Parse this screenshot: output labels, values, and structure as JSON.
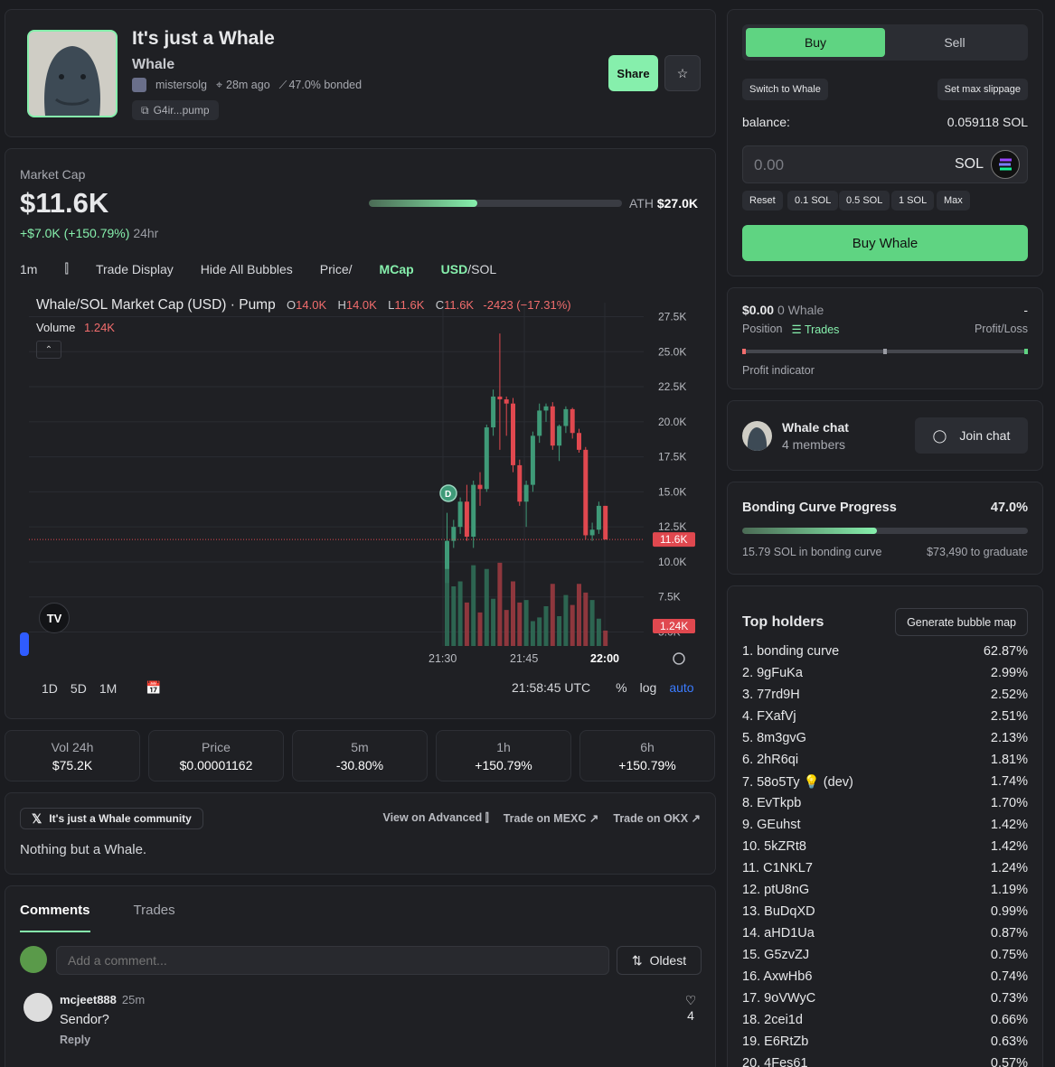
{
  "token": {
    "name": "It's just a Whale",
    "symbol": "Whale",
    "creator": "mistersolg",
    "age": "28m ago",
    "bonded": "47.0% bonded",
    "ca": "G4ir...pump",
    "share_label": "Share"
  },
  "market": {
    "label": "Market Cap",
    "value": "$11.6K",
    "change": "+$7.0K (+150.79%)",
    "period": "24hr",
    "ath_label": "ATH",
    "ath_value": "$27.0K",
    "ath_progress": 0.43
  },
  "toolbar": {
    "interval": "1m",
    "trade_display": "Trade Display",
    "hide_bubbles": "Hide All Bubbles",
    "price": "Price/",
    "mcap": "MCap",
    "usd": "USD",
    "sol": "/SOL"
  },
  "chart": {
    "title": "Whale/SOL Market Cap (USD) · Pump",
    "o_label": "O",
    "o": "14.0K",
    "h_label": "H",
    "h": "14.0K",
    "l_label": "L",
    "l": "11.6K",
    "c_label": "C",
    "c": "11.6K",
    "change": "-2423 (−17.31%)",
    "volume_label": "Volume",
    "volume_value": "1.24K",
    "current_price_tag": "11.6K",
    "current_volume_tag": "1.24K",
    "time_utc": "21:58:45 UTC",
    "ranges": [
      "1D",
      "5D",
      "1M"
    ],
    "scale_opts": {
      "pct": "%",
      "log": "log",
      "auto": "auto"
    },
    "dev_marker": "D",
    "tv_logo": "TV"
  },
  "chart_data": {
    "type": "candlestick",
    "ylabel": "",
    "y_ticks": [
      "27.5K",
      "25.0K",
      "22.5K",
      "20.0K",
      "17.5K",
      "15.0K",
      "12.5K",
      "10.0K",
      "7.5K",
      "5.0K"
    ],
    "x_ticks": [
      "21:30",
      "21:45",
      "22:00"
    ],
    "ylim": [
      4000,
      28500
    ],
    "candles": [
      {
        "o": 8500,
        "h": 13500,
        "l": 8500,
        "c": 11500
      },
      {
        "o": 11500,
        "h": 13000,
        "l": 11000,
        "c": 12500
      },
      {
        "o": 12500,
        "h": 14600,
        "l": 12000,
        "c": 14300
      },
      {
        "o": 14300,
        "h": 15500,
        "l": 11500,
        "c": 11800
      },
      {
        "o": 11800,
        "h": 15800,
        "l": 11000,
        "c": 15500
      },
      {
        "o": 15500,
        "h": 16400,
        "l": 14000,
        "c": 15200
      },
      {
        "o": 15200,
        "h": 19800,
        "l": 15000,
        "c": 19600
      },
      {
        "o": 19600,
        "h": 22300,
        "l": 19000,
        "c": 21800
      },
      {
        "o": 21800,
        "h": 26300,
        "l": 18000,
        "c": 21600
      },
      {
        "o": 21600,
        "h": 21800,
        "l": 19000,
        "c": 21300
      },
      {
        "o": 21300,
        "h": 21700,
        "l": 16400,
        "c": 16900
      },
      {
        "o": 16900,
        "h": 17300,
        "l": 14000,
        "c": 14300
      },
      {
        "o": 14300,
        "h": 15800,
        "l": 12500,
        "c": 15500
      },
      {
        "o": 15500,
        "h": 19300,
        "l": 15000,
        "c": 19000
      },
      {
        "o": 19000,
        "h": 21300,
        "l": 18500,
        "c": 20800
      },
      {
        "o": 20800,
        "h": 21300,
        "l": 20000,
        "c": 21100
      },
      {
        "o": 21100,
        "h": 21400,
        "l": 18000,
        "c": 18300
      },
      {
        "o": 18300,
        "h": 19800,
        "l": 17200,
        "c": 19700
      },
      {
        "o": 19700,
        "h": 21100,
        "l": 19200,
        "c": 20900
      },
      {
        "o": 20900,
        "h": 21000,
        "l": 18800,
        "c": 19200
      },
      {
        "o": 19200,
        "h": 19500,
        "l": 17800,
        "c": 18000
      },
      {
        "o": 18000,
        "h": 18200,
        "l": 11600,
        "c": 11900
      },
      {
        "o": 11900,
        "h": 12800,
        "l": 11500,
        "c": 12300
      },
      {
        "o": 12300,
        "h": 14300,
        "l": 12000,
        "c": 14000
      },
      {
        "o": 14000,
        "h": 14000,
        "l": 11600,
        "c": 11600
      }
    ],
    "volumes": [
      6200,
      4800,
      5200,
      3500,
      6500,
      2700,
      6200,
      3800,
      6700,
      2900,
      5200,
      3500,
      3700,
      2000,
      2300,
      3200,
      5000,
      2400,
      4100,
      3300,
      5000,
      4300,
      3700,
      2200,
      1240
    ]
  },
  "stats": [
    {
      "label": "Vol 24h",
      "value": "$75.2K"
    },
    {
      "label": "Price",
      "value": "$0.00001162"
    },
    {
      "label": "5m",
      "value": "-30.80%"
    },
    {
      "label": "1h",
      "value": "+150.79%"
    },
    {
      "label": "6h",
      "value": "+150.79%"
    }
  ],
  "community": {
    "chip": "It's just a Whale community",
    "advanced": "View on Advanced",
    "mexc": "Trade on MEXC",
    "okx": "Trade on OKX",
    "description": "Nothing but a Whale."
  },
  "comments": {
    "tab_comments": "Comments",
    "tab_trades": "Trades",
    "placeholder": "Add a comment...",
    "sort": "Oldest",
    "items": [
      {
        "user": "mcjeet888",
        "time": "25m",
        "text": "Sendor?",
        "reply": "Reply",
        "likes": "4"
      }
    ]
  },
  "trade": {
    "buy": "Buy",
    "sell": "Sell",
    "switch": "Switch to Whale",
    "slippage": "Set max slippage",
    "balance_label": "balance:",
    "balance_value": "0.059118 SOL",
    "amount_placeholder": "0.00",
    "currency": "SOL",
    "quick": [
      "Reset",
      "0.1 SOL",
      "0.5 SOL",
      "1 SOL",
      "Max"
    ],
    "buy_button": "Buy Whale"
  },
  "position": {
    "value": "$0.00",
    "tokens": "0 Whale",
    "pl_value": "-",
    "position_label": "Position",
    "trades_label": "Trades",
    "pl_label": "Profit/Loss",
    "indicator_label": "Profit indicator"
  },
  "chat": {
    "title": "Whale chat",
    "members": "4 members",
    "join": "Join chat"
  },
  "bonding": {
    "title": "Bonding Curve Progress",
    "percent": "47.0%",
    "progress": 0.47,
    "in_curve": "15.79 SOL in bonding curve",
    "to_graduate": "$73,490 to graduate"
  },
  "holders": {
    "title": "Top holders",
    "bubble_btn": "Generate bubble map",
    "rows": [
      {
        "name": "1. bonding curve",
        "pct": "62.87%"
      },
      {
        "name": "2. 9gFuKa",
        "pct": "2.99%"
      },
      {
        "name": "3. 77rd9H",
        "pct": "2.52%"
      },
      {
        "name": "4. FXafVj",
        "pct": "2.51%"
      },
      {
        "name": "5. 8m3gvG",
        "pct": "2.13%"
      },
      {
        "name": "6. 2hR6qi",
        "pct": "1.81%"
      },
      {
        "name": "7. 58o5Ty 💡 (dev)",
        "pct": "1.74%"
      },
      {
        "name": "8. EvTkpb",
        "pct": "1.70%"
      },
      {
        "name": "9. GEuhst",
        "pct": "1.42%"
      },
      {
        "name": "10. 5kZRt8",
        "pct": "1.42%"
      },
      {
        "name": "11. C1NKL7",
        "pct": "1.24%"
      },
      {
        "name": "12. ptU8nG",
        "pct": "1.19%"
      },
      {
        "name": "13. BuDqXD",
        "pct": "0.99%"
      },
      {
        "name": "14. aHD1Ua",
        "pct": "0.87%"
      },
      {
        "name": "15. G5zvZJ",
        "pct": "0.75%"
      },
      {
        "name": "16. AxwHb6",
        "pct": "0.74%"
      },
      {
        "name": "17. 9oVWyC",
        "pct": "0.73%"
      },
      {
        "name": "18. 2cei1d",
        "pct": "0.66%"
      },
      {
        "name": "19. E6RtZb",
        "pct": "0.63%"
      },
      {
        "name": "20. 4Fes61",
        "pct": "0.57%"
      }
    ]
  }
}
